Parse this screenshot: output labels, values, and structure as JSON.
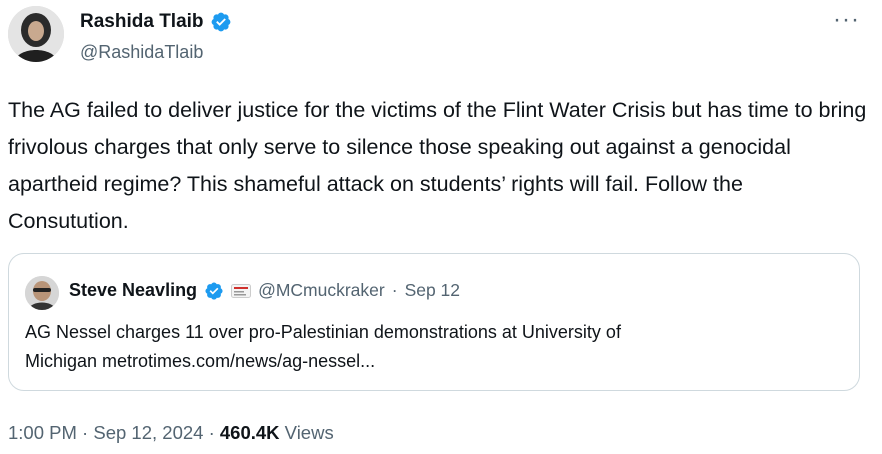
{
  "author": {
    "name": "Rashida Tlaib",
    "handle": "@RashidaTlaib"
  },
  "tweet": {
    "text": "The AG failed to deliver justice for the victims of the Flint Water Crisis but has time to bring frivolous charges that only serve to silence those speaking out against a genocidal apartheid regime? This shameful attack on students’ rights will fail. Follow the Consutution."
  },
  "more_icon": "···",
  "quoted": {
    "name": "Steve Neavling",
    "handle": "@MCmuckraker",
    "separator": "·",
    "date": "Sep 12",
    "text_line1": "AG Nessel charges 11 over pro-Palestinian demonstrations at University of",
    "text_line2": "Michigan metrotimes.com/news/ag-nessel..."
  },
  "meta": {
    "time": "1:00 PM",
    "dot1": " · ",
    "date": "Sep 12, 2024",
    "dot2": " · ",
    "views_count": "460.4K",
    "views_label": " Views"
  },
  "colors": {
    "verified": "#1d9bf0",
    "secondary_text": "#536471",
    "primary_text": "#0f1419",
    "border": "#cfd9de"
  },
  "icons": {
    "verified": "verified-badge-icon",
    "more": "more-options-icon",
    "flag": "affiliation-badge-icon"
  }
}
